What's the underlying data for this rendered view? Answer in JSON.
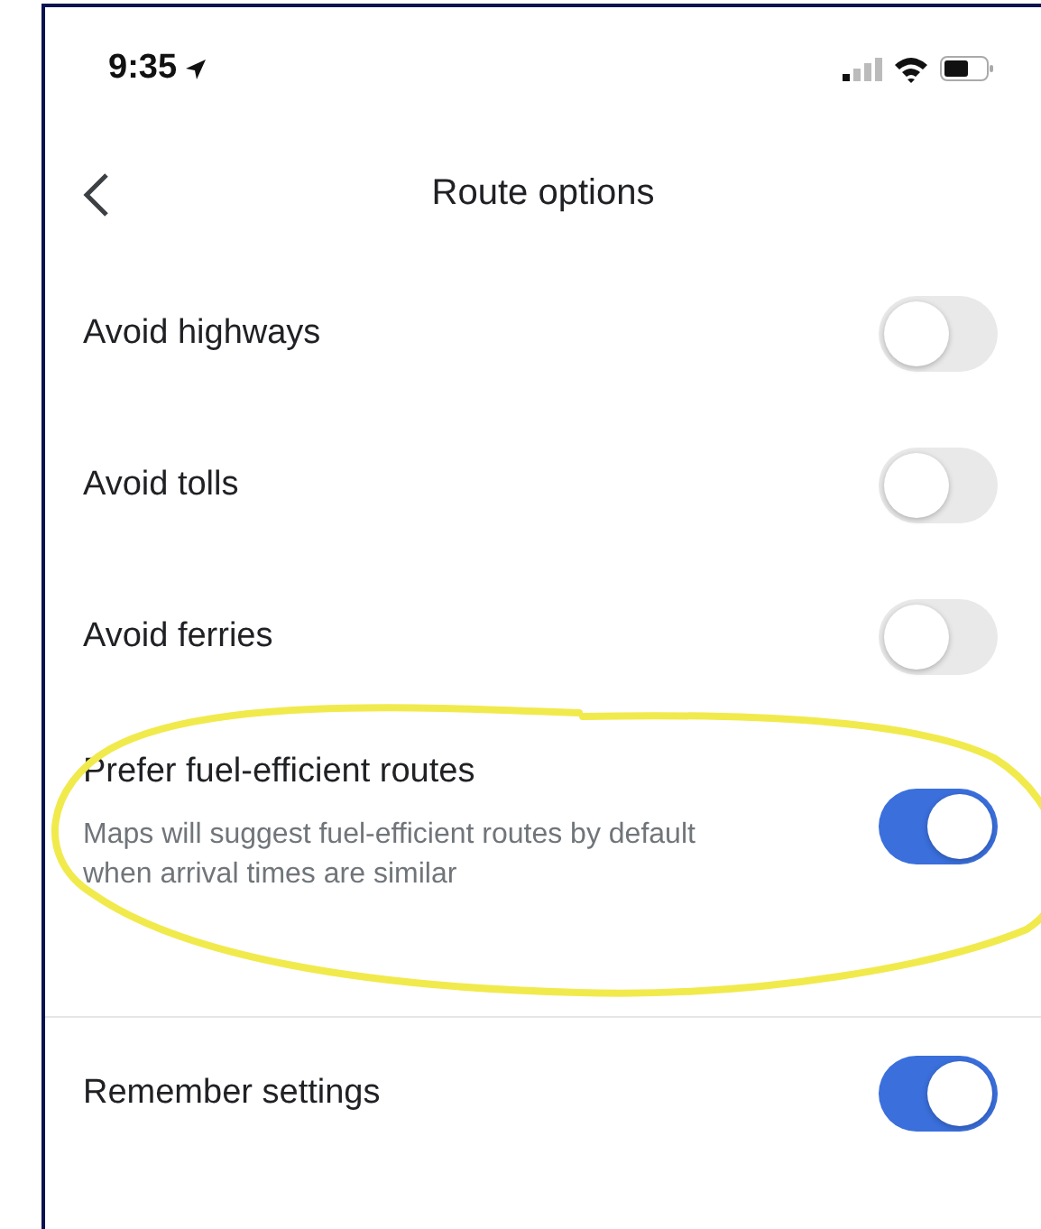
{
  "status_bar": {
    "time": "9:35"
  },
  "header": {
    "title": "Route options"
  },
  "settings": [
    {
      "label": "Avoid highways",
      "on": false
    },
    {
      "label": "Avoid tolls",
      "on": false
    },
    {
      "label": "Avoid ferries",
      "on": false
    },
    {
      "label": "Prefer fuel-efficient routes",
      "description": "Maps will suggest fuel-efficient routes by default when arrival times are similar",
      "on": true
    },
    {
      "label": "Remember settings",
      "on": true,
      "divider_above": true
    }
  ]
}
